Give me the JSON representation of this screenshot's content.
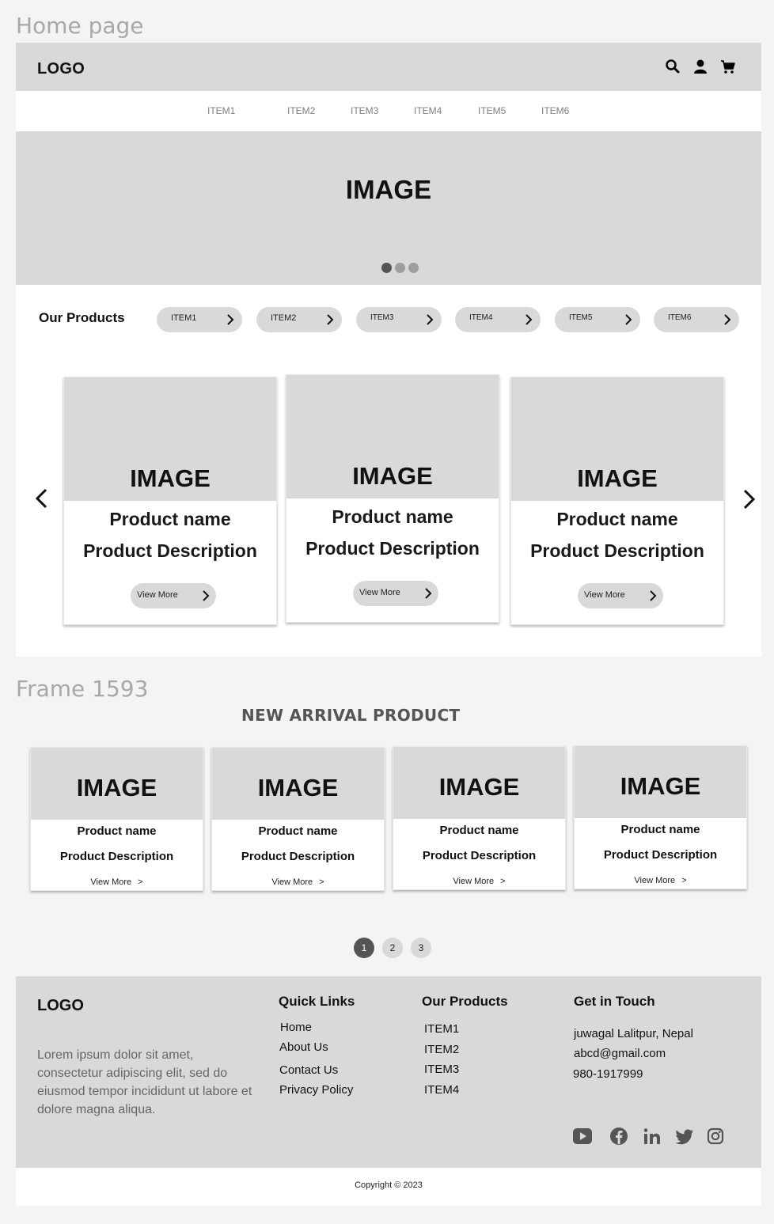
{
  "frame_labels": {
    "home": "Home page",
    "frame": "Frame 1593"
  },
  "header": {
    "logo": "LOGO",
    "icons": [
      "search-icon",
      "user-icon",
      "cart-icon"
    ]
  },
  "nav": {
    "items": [
      "ITEM1",
      "ITEM2",
      "ITEM3",
      "ITEM4",
      "ITEM5",
      "ITEM6"
    ]
  },
  "hero": {
    "image_text": "IMAGE",
    "dots": 3,
    "active_dot": 1
  },
  "products": {
    "title": "Our Products",
    "filters": [
      "ITEM1",
      "ITEM2",
      "ITEM3",
      "ITEM4",
      "ITEM5",
      "ITEM6"
    ],
    "cards": [
      {
        "image": "IMAGE",
        "name": "Product name",
        "description": "Product Description",
        "button": "View More"
      },
      {
        "image": "IMAGE",
        "name": "Product name",
        "description": "Product Description",
        "button": "View More"
      },
      {
        "image": "IMAGE",
        "name": "Product name",
        "description": "Product Description",
        "button": "View More"
      }
    ]
  },
  "new_arrival": {
    "title": "NEW ARRIVAL PRODUCT",
    "cards": [
      {
        "image": "IMAGE",
        "name": "Product name",
        "description": "Product Description",
        "link": "View More",
        "arrow": ">"
      },
      {
        "image": "IMAGE",
        "name": "Product name",
        "description": "Product Description",
        "link": "View More",
        "arrow": ">"
      },
      {
        "image": "IMAGE",
        "name": "Product name",
        "description": "Product Description",
        "link": "View More",
        "arrow": ">"
      },
      {
        "image": "IMAGE",
        "name": "Product name",
        "description": "Product Description",
        "link": "View More",
        "arrow": ">"
      }
    ],
    "pages": [
      "1",
      "2",
      "3"
    ],
    "active_page": "1"
  },
  "footer": {
    "logo": "LOGO",
    "about": "Lorem ipsum dolor sit amet, consectetur adipiscing elit, sed do eiusmod tempor incididunt ut labore et dolore magna aliqua.",
    "quick_links": {
      "title": "Quick Links",
      "items": [
        "Home",
        "About Us",
        "Contact Us",
        "Privacy Policy"
      ]
    },
    "our_products": {
      "title": "Our Products",
      "items": [
        "ITEM1",
        "ITEM2",
        "ITEM3",
        "ITEM4"
      ]
    },
    "contact": {
      "title": "Get in Touch",
      "address": "juwagal Lalitpur, Nepal",
      "email": "abcd@gmail.com",
      "phone": "980-1917999"
    },
    "social": [
      "youtube-icon",
      "facebook-icon",
      "linkedin-icon",
      "twitter-icon",
      "instagram-icon"
    ],
    "copyright": "Copyright © 2023"
  },
  "colors": {
    "placeholder": "#d9d9d9",
    "dark": "#555555",
    "muted_text": "#808080"
  }
}
